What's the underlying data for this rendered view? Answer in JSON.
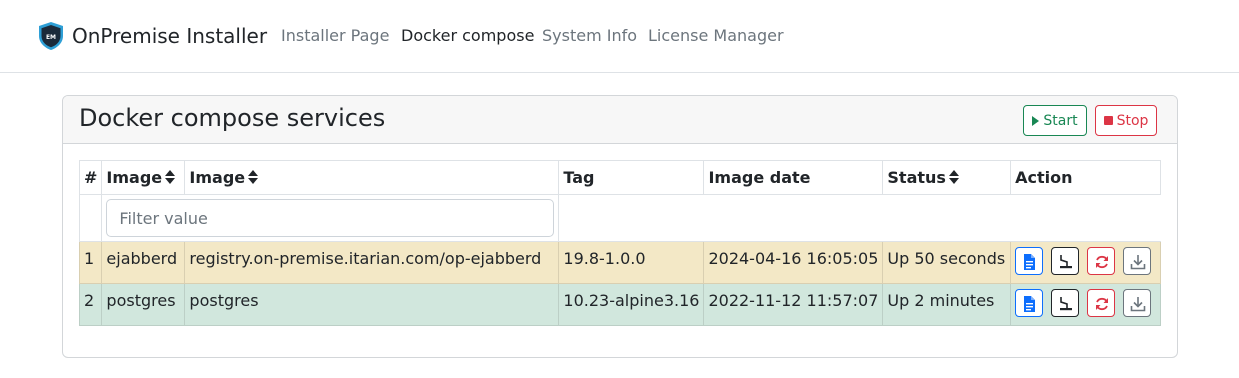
{
  "brand": {
    "name": "OnPremise Installer",
    "logo_text": "EM"
  },
  "nav": [
    {
      "label": "Installer Page",
      "active": false
    },
    {
      "label": "Docker compose",
      "active": true
    },
    {
      "label": "System Info",
      "active": false
    },
    {
      "label": "License Manager",
      "active": false
    }
  ],
  "card": {
    "title": "Docker compose services",
    "start_label": "Start",
    "stop_label": "Stop"
  },
  "table": {
    "headers": [
      "#",
      "Image",
      "Image",
      "Tag",
      "Image date",
      "Status",
      "Action"
    ],
    "filter_placeholder": "Filter value",
    "rows": [
      {
        "num": "1",
        "name": "ejabberd",
        "image": "registry.on-premise.itarian.com/op-ejabberd",
        "tag": "19.8-1.0.0",
        "date": "2024-04-16 16:05:05",
        "status": "Up 50 seconds"
      },
      {
        "num": "2",
        "name": "postgres",
        "image": "postgres",
        "tag": "10.23-alpine3.16",
        "date": "2022-11-12 11:57:07",
        "status": "Up 2 minutes"
      }
    ]
  },
  "colors": {
    "start": "#198754",
    "stop": "#dc3545",
    "row_warning": "#f3e8c6",
    "row_success": "#d1e7dd",
    "primary": "#0d6efd"
  },
  "icons": [
    "shield-logo-icon",
    "play-icon",
    "stop-icon",
    "sort-icon",
    "file-icon",
    "terminal-icon",
    "restart-icon",
    "download-icon"
  ]
}
